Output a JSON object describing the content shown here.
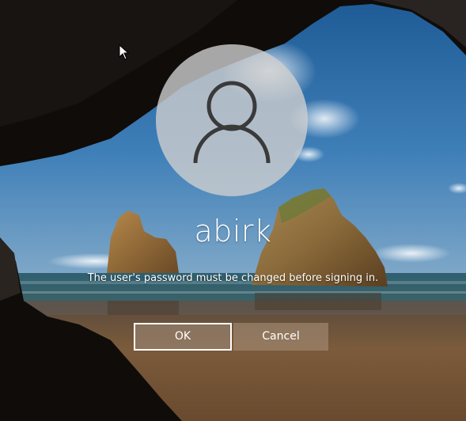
{
  "login": {
    "username": "abirk",
    "message": "The user's password must be changed before signing in.",
    "ok_label": "OK",
    "cancel_label": "Cancel"
  },
  "icons": {
    "avatar": "user-silhouette-icon",
    "cursor": "mouse-pointer-icon"
  },
  "colors": {
    "sky": "#2f6fa8",
    "sea": "#2e5a6a",
    "sand": "#7a5a3a",
    "cave": "#0e0b09",
    "text": "#ffffff"
  }
}
